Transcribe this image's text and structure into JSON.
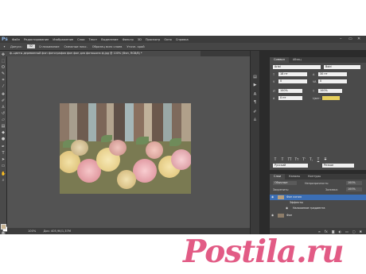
{
  "app": {
    "logo": "Ps",
    "menu": [
      "Файл",
      "Редактирование",
      "Изображение",
      "Слои",
      "Текст",
      "Выделение",
      "Фильтр",
      "3D",
      "Просмотр",
      "Окно",
      "Справка"
    ],
    "window_controls": [
      "–",
      "▭",
      "✕"
    ]
  },
  "options_bar": {
    "items": [
      "Допуск:",
      "Сглаживание",
      "Смежные пикс.",
      "Образец всех слоев",
      "Уточн. край"
    ],
    "tolerance": "32"
  },
  "document": {
    "tab_title": "ф.-цветы деревянный фон фотография фон фон для фотошопа ф.jpg @ 100% (Фон, RGB/8) *",
    "status_left": "100%",
    "status_doc": "Док: 405,9K/1,37M"
  },
  "char_panel": {
    "tabs": [
      "Символ",
      "Абзац"
    ],
    "font_family": "Arial",
    "font_style": "Bold",
    "size": "18 пт",
    "leading": "30 пт",
    "kerning": "0",
    "tracking": "0",
    "vscale": "100%",
    "hscale": "100%",
    "baseline": "0 пт",
    "color_label": "Цвет:",
    "language": "Русский",
    "aa": "Резкое",
    "style_buttons": [
      "T",
      "T",
      "TT",
      "Tт",
      "T'",
      "T,",
      "T",
      "T"
    ]
  },
  "layers_panel": {
    "tabs": [
      "Слои",
      "Каналы",
      "Контуры"
    ],
    "blend": "Обычные",
    "opacity_label": "Непрозрачность:",
    "opacity": "100%",
    "fill_label": "Заливка:",
    "fill": "100%",
    "lock_label": "Закрепить:",
    "rows": [
      {
        "name": "Фон копия",
        "selected": true
      },
      {
        "name": "Эффекты",
        "selected": false
      },
      {
        "name": "Наложение градиента",
        "selected": false
      },
      {
        "name": "Фон",
        "selected": false
      }
    ]
  },
  "watermark": {
    "text": "Postila.ru"
  }
}
